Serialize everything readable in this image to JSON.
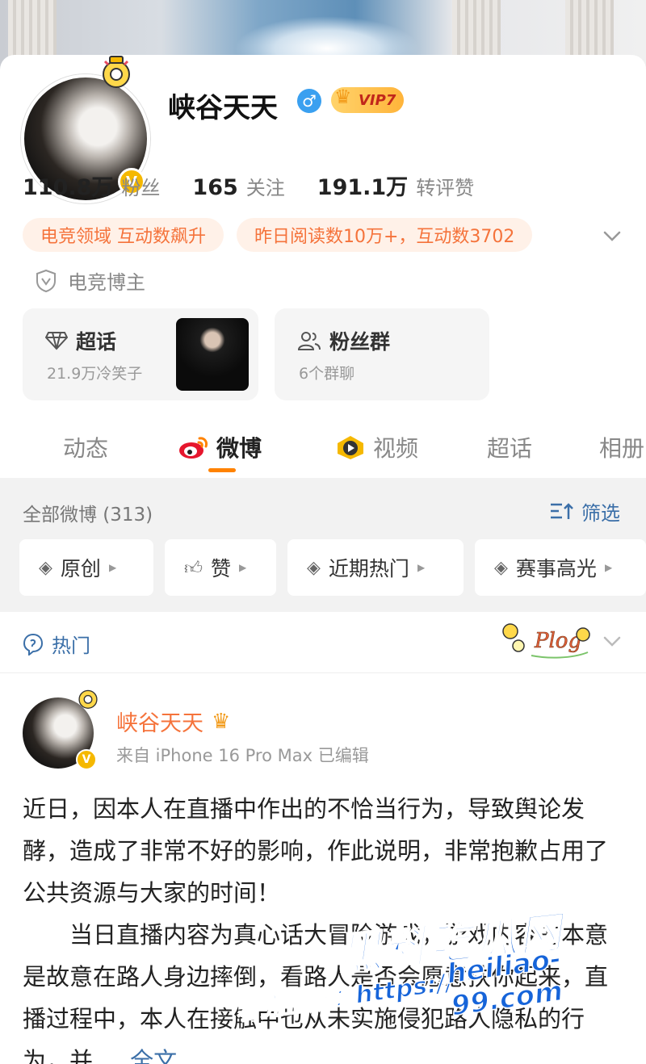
{
  "profile": {
    "name": "峡谷天天",
    "gender_icon": "male-icon",
    "vip_label": "VIP7",
    "verified_mark": "V",
    "stats": [
      {
        "num": "110.8万",
        "label": "粉丝"
      },
      {
        "num": "165",
        "label": "关注"
      },
      {
        "num": "191.1万",
        "label": "转评赞"
      }
    ],
    "tags": [
      "电竞领域 互动数飙升",
      "昨日阅读数10万+，互动数3702"
    ],
    "certification": "电竞博主"
  },
  "features": {
    "supertopic": {
      "title": "超话",
      "sub": "21.9万冷笑子"
    },
    "fangroup": {
      "title": "粉丝群",
      "sub": "6个群聊"
    }
  },
  "tabs": [
    "动态",
    "微博",
    "视频",
    "超话",
    "相册"
  ],
  "active_tab": "微博",
  "filter": {
    "all_label": "全部微博 (313)",
    "filter_button": "筛选",
    "chips": [
      "原创",
      "赞",
      "近期热门",
      "赛事高光"
    ]
  },
  "hot": {
    "label": "热门",
    "sticker_text": "Plog"
  },
  "post": {
    "author": "峡谷天天",
    "meta": "来自 iPhone 16 Pro Max  已编辑",
    "paragraph1": "近日，因本人在直播中作出的不恰当行为，导致舆论发酵，造成了非常不好的影响，作此说明，非常抱歉占用了公共资源与大家的时间！",
    "paragraph2": "　　当日直播内容为真心话大冒险游戏，游戏内容的本意是故意在路人身边摔倒，看路人是否会愿意扶你起来，直播过程中，本人在接触中也从未实施侵犯路人隐私的行为，并 ... ",
    "more": "全文"
  },
  "watermark": {
    "site_name": "黑料吃瓜网",
    "cta": "看完整版：https://",
    "domain": "heiliao-99.com"
  },
  "colors": {
    "accent": "#ff8200",
    "link": "#3b6fa8",
    "tag_text": "#f5733b",
    "tag_bg": "#fff1e8",
    "verified": "#f5b800"
  }
}
